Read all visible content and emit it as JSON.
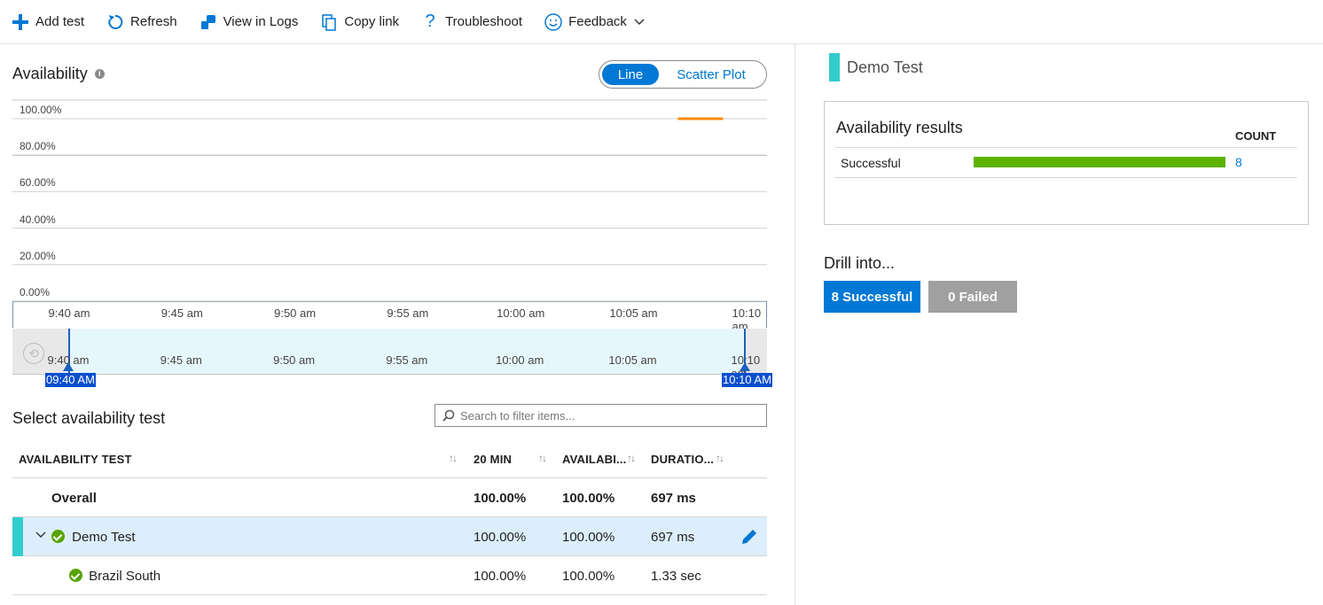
{
  "toolbar": {
    "items": [
      {
        "label": "Add test",
        "icon": "plus-icon"
      },
      {
        "label": "Refresh",
        "icon": "refresh-icon"
      },
      {
        "label": "View in Logs",
        "icon": "logs-icon"
      },
      {
        "label": "Copy link",
        "icon": "copy-icon"
      },
      {
        "label": "Troubleshoot",
        "icon": "question-icon"
      },
      {
        "label": "Feedback",
        "icon": "smiley-icon"
      }
    ]
  },
  "availability": {
    "title": "Availability",
    "toggle": {
      "line": "Line",
      "scatter": "Scatter Plot",
      "selected": "Line"
    }
  },
  "chart_data": {
    "type": "line",
    "y_ticks": [
      "100.00%",
      "80.00%",
      "60.00%",
      "40.00%",
      "20.00%",
      "0.00%"
    ],
    "ylim": [
      0,
      100
    ],
    "x_ticks": [
      "9:40 am",
      "9:45 am",
      "9:50 am",
      "9:55 am",
      "10:00 am",
      "10:05 am",
      "10:10 am"
    ],
    "series": [
      {
        "color": "#ff8c00",
        "points": [
          {
            "x": "10:07 am",
            "y": 100
          },
          {
            "x": "10:09 am",
            "y": 100
          }
        ]
      }
    ],
    "grid": true
  },
  "brush": {
    "x_ticks": [
      "9:40 am",
      "9:45 am",
      "9:50 am",
      "9:55 am",
      "10:00 am",
      "10:05 am",
      "10:10 am"
    ],
    "start_label": "09:40 AM",
    "end_label": "10:10 AM"
  },
  "select": {
    "title": "Select availability test",
    "search_placeholder": "Search to filter items...",
    "columns": [
      "AVAILABILITY TEST",
      "20 MIN",
      "AVAILABI...",
      "DURATIO..."
    ],
    "overall": {
      "name": "Overall",
      "min20": "100.00%",
      "avail": "100.00%",
      "duration": "697 ms"
    },
    "test": {
      "name": "Demo Test",
      "min20": "100.00%",
      "avail": "100.00%",
      "duration": "697 ms"
    },
    "location": {
      "name": "Brazil South",
      "min20": "100.00%",
      "avail": "100.00%",
      "duration": "1.33 sec"
    }
  },
  "detail": {
    "test_name": "Demo Test",
    "results_title": "Availability results",
    "count_header": "COUNT",
    "result_label": "Successful",
    "result_count": "8",
    "drill_title": "Drill into...",
    "successful_button": "8 Successful",
    "failed_button": "0 Failed"
  },
  "colors": {
    "accent": "#0078d4",
    "test_color": "#33cccc",
    "success": "#57a300",
    "series": "#ff8c00"
  }
}
